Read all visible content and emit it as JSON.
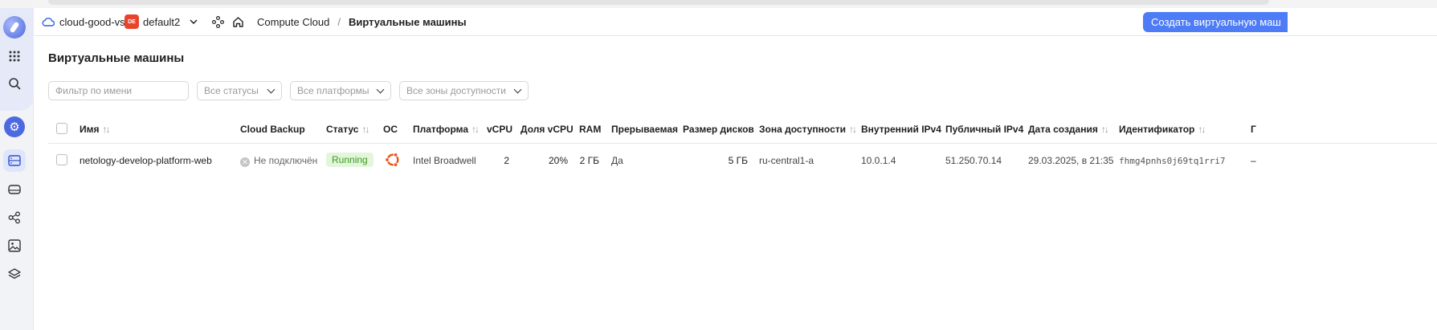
{
  "header": {
    "cloud": "cloud-good-vs",
    "folder_badge": "DE",
    "folder": "default2",
    "service": "Compute Cloud",
    "separator": "/",
    "current": "Виртуальные машины",
    "create_button": "Создать виртуальную маш"
  },
  "page": {
    "title": "Виртуальные машины"
  },
  "filters": {
    "name_placeholder": "Фильтр по имени",
    "status": "Все статусы",
    "platform": "Все платформы",
    "zone": "Все зоны доступности"
  },
  "table": {
    "columns": {
      "name": "Имя",
      "backup": "Cloud Backup",
      "status": "Статус",
      "os": "ОС",
      "platform": "Платформа",
      "vcpu": "vCPU",
      "vcpu_share": "Доля vCPU",
      "ram": "RAM",
      "preemptible": "Прерываемая",
      "disk_size": "Размер дисков",
      "zone": "Зона доступности",
      "internal_ip": "Внутренний IPv4",
      "public_ip": "Публичный IPv4",
      "created": "Дата создания",
      "id": "Идентификатор",
      "extra": "Г"
    },
    "sort_glyph": "↑↓",
    "rows": [
      {
        "name": "netology-develop-platform-web",
        "backup": "Не подключён",
        "status": "Running",
        "os_icon": "ubuntu-icon",
        "platform": "Intel Broadwell",
        "vcpu": "2",
        "vcpu_share": "20%",
        "ram": "2 ГБ",
        "preemptible": "Да",
        "disk_size": "5 ГБ",
        "zone": "ru-central1-a",
        "internal_ip": "10.0.1.4",
        "public_ip": "51.250.70.14",
        "created": "29.03.2025, в 21:35",
        "id": "fhmg4pnhs0j69tq1rri7",
        "extra": "–"
      }
    ]
  },
  "colors": {
    "accent": "#4d7cf6",
    "running_bg": "#e3f6dc",
    "running_fg": "#3b9a22",
    "ubuntu": "#e95420"
  }
}
